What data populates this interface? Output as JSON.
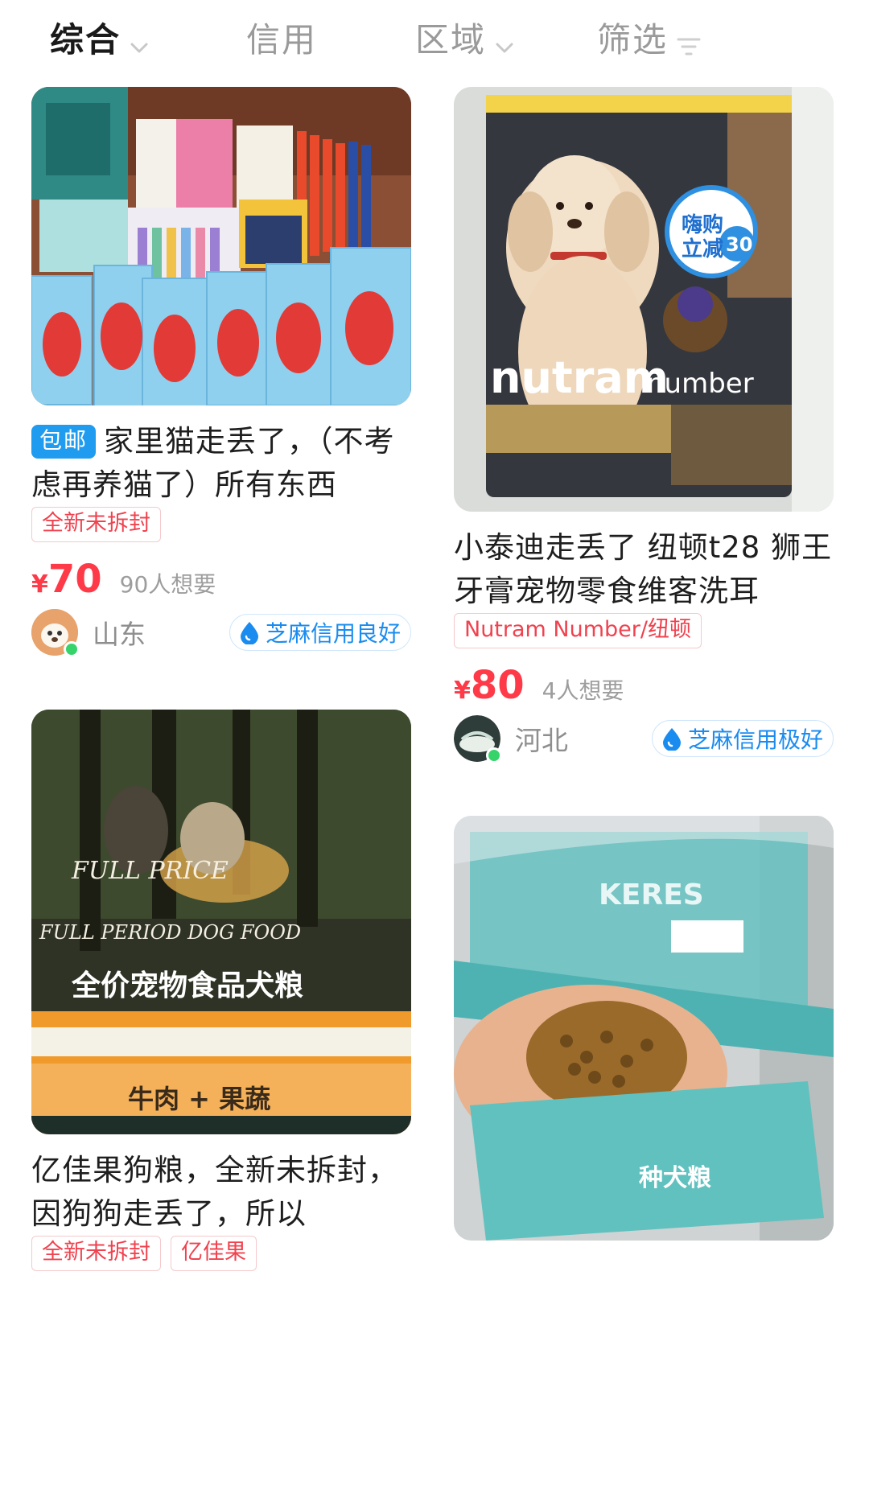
{
  "filter_bar": {
    "items": [
      {
        "label": "综合",
        "active": true,
        "icon": "chevron-down-icon"
      },
      {
        "label": "信用",
        "active": false
      },
      {
        "label": "区域",
        "active": false,
        "icon": "chevron-down-icon"
      },
      {
        "label": "筛选",
        "active": false,
        "icon": "filter-icon"
      }
    ]
  },
  "colors": {
    "price": "#ff3a48",
    "tag_border": "#f5c9cc",
    "tag_text": "#f0424f",
    "credit_blue": "#1a8cf0",
    "baoyou_bg": "#1f9cf0",
    "online_dot": "#36d36b"
  },
  "listings": [
    {
      "badge": "包邮",
      "title": "家里猫走丢了，（不考虑再养猫了）所有东西",
      "tags": [
        "全新未拆封"
      ],
      "price_symbol": "¥",
      "price": "70",
      "want": "90人想要",
      "region": "山东",
      "credit": "芝麻信用良好",
      "image": "cat-food-pouches-photo"
    },
    {
      "title": "小泰迪走丢了  纽顿t28 狮王牙膏宠物零食维客洗耳",
      "tags": [
        "Nutram Number/纽顿"
      ],
      "price_symbol": "¥",
      "price": "80",
      "want": "4人想要",
      "region": "河北",
      "credit": "芝麻信用极好",
      "image": "poodle-dog-food-bag-photo",
      "image_text": {
        "brand": "nutram",
        "brand2": "number",
        "promo1": "嗨购",
        "promo2": "立减",
        "promo_num": "30"
      }
    },
    {
      "title": "亿佳果狗粮，全新未拆封，因狗狗走丢了，所以",
      "tags": [
        "全新未拆封",
        "亿佳果"
      ],
      "image": "dog-food-sack-photo",
      "image_text": {
        "line1": "FULL PRICE",
        "line2": "FULL PERIOD DOG FOOD",
        "cn": "全价宠物食品犬粮",
        "flavor": "牛肉 + 果蔬"
      }
    },
    {
      "image": "kibble-in-hand-photo",
      "image_text": {
        "brand": "KERES",
        "label": "种犬粮"
      }
    }
  ]
}
